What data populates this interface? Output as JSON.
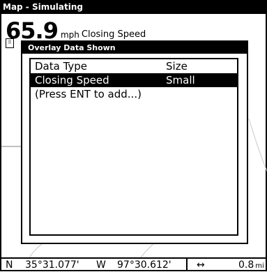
{
  "window": {
    "title": "Map - Simulating"
  },
  "readout": {
    "value": "65.9",
    "unit": "mph",
    "label": "Closing Speed"
  },
  "dialog": {
    "title": "Overlay Data Shown",
    "header": {
      "type": "Data Type",
      "size": "Size"
    },
    "rows": [
      {
        "type": "Closing Speed",
        "size": "Small",
        "selected": true
      },
      {
        "type": "(Press ENT to add...)",
        "size": "",
        "selected": false
      }
    ]
  },
  "statusbar": {
    "lat_hemisphere": "N",
    "latitude": "35°31.077'",
    "lon_hemisphere": "W",
    "longitude": "97°30.612'",
    "range_icon": "left-right-arrow-icon",
    "range_value": "0.8",
    "range_unit": "mi"
  }
}
